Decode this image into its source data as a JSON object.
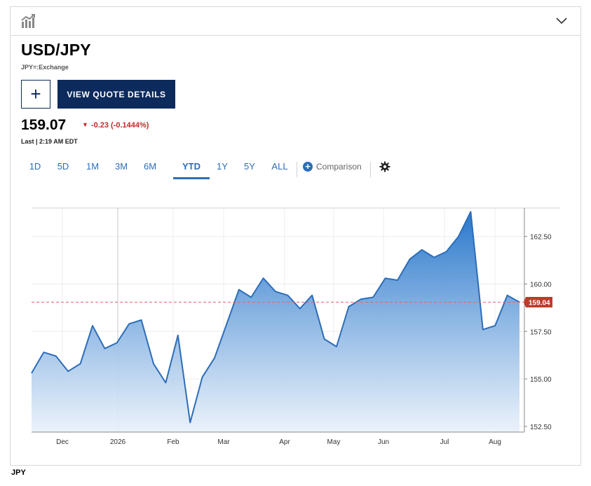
{
  "header": {
    "chart_icon": "chart-bars-icon",
    "collapse_icon": "chevron-down-icon"
  },
  "quote": {
    "symbol": "USD/JPY",
    "exchange": "JPY=:Exchange",
    "add_label": "+",
    "view_details_label": "VIEW QUOTE DETAILS",
    "price": "159.07",
    "change": "-0.23 (-0.1444%)",
    "last_updated": "Last | 2:19 AM EDT",
    "change_color": "#c62828",
    "accent_color": "#0c2a5c"
  },
  "ranges": [
    "1D",
    "5D",
    "1M",
    "3M",
    "6M",
    "YTD",
    "1Y",
    "5Y",
    "ALL"
  ],
  "active_range": "YTD",
  "comparison_label": "Comparison",
  "settings_icon": "gear-icon",
  "footer_label": "JPY",
  "chart_data": {
    "type": "area",
    "x_tick_labels": [
      "Dec",
      "2026",
      "Feb",
      "Mar",
      "Apr",
      "May",
      "Jun",
      "Jul",
      "Aug"
    ],
    "y_ticks": [
      "152.50",
      "155.00",
      "157.50",
      "160.00",
      "162.50"
    ],
    "ylim": [
      152.2,
      164.0
    ],
    "current_value": "159.04",
    "reference_line": 159.04,
    "series": [
      {
        "values": [
          155.3,
          156.4,
          156.2,
          155.4,
          155.8,
          157.8,
          156.6,
          156.9,
          157.9,
          158.1,
          155.8,
          154.8,
          157.3,
          152.7,
          155.1,
          156.1,
          157.9,
          159.7,
          159.3,
          160.3,
          159.6,
          159.4,
          158.7,
          159.4,
          157.1,
          156.7,
          158.8,
          159.2,
          159.3,
          160.3,
          160.2,
          161.3,
          161.8,
          161.4,
          161.7,
          162.5,
          163.8,
          157.6,
          157.8,
          159.4,
          159.04
        ]
      }
    ],
    "line_color": "#2c6db8",
    "fill_top_color": "#2a78cc",
    "fill_bottom_color": "#e9f1fa",
    "reference_color": "#e06666",
    "last_price_badge_color": "#c0392b",
    "grid": true
  }
}
